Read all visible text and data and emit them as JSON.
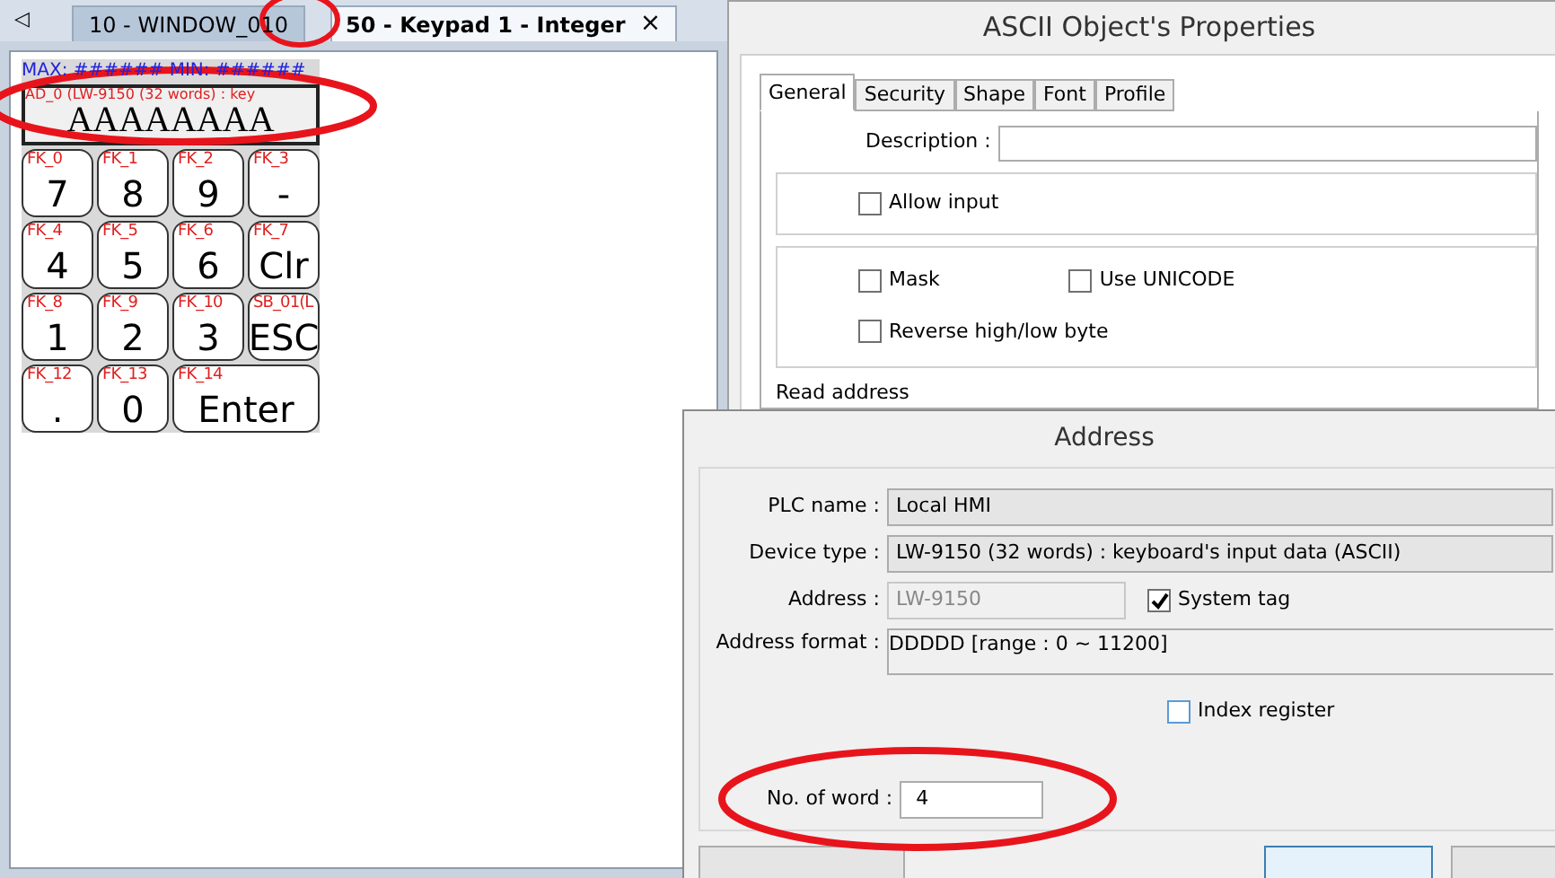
{
  "editor": {
    "scroll_arrow": "◁",
    "tabs": [
      {
        "label": "10 - WINDOW_010",
        "selected": false,
        "closable": false
      },
      {
        "label": "50 - Keypad 1 - Integer",
        "selected": true,
        "closable": true
      }
    ],
    "close_glyph": "×",
    "keypad": {
      "range_label": "MAX: ######  MIN: ######",
      "display_label": "AD_0 (LW-9150 (32 words) : key",
      "display_value": "AAAAAAAA",
      "keys": [
        {
          "tag": "FK_0",
          "label": "7",
          "wide": false
        },
        {
          "tag": "FK_1",
          "label": "8",
          "wide": false
        },
        {
          "tag": "FK_2",
          "label": "9",
          "wide": false
        },
        {
          "tag": "FK_3",
          "label": "-",
          "wide": false
        },
        {
          "tag": "FK_4",
          "label": "4",
          "wide": false
        },
        {
          "tag": "FK_5",
          "label": "5",
          "wide": false
        },
        {
          "tag": "FK_6",
          "label": "6",
          "wide": false
        },
        {
          "tag": "FK_7",
          "label": "Clr",
          "wide": false
        },
        {
          "tag": "FK_8",
          "label": "1",
          "wide": false
        },
        {
          "tag": "FK_9",
          "label": "2",
          "wide": false
        },
        {
          "tag": "FK_10",
          "label": "3",
          "wide": false
        },
        {
          "tag": "SB_01(L",
          "label": "ESC",
          "wide": false
        },
        {
          "tag": "FK_12",
          "label": ".",
          "wide": false
        },
        {
          "tag": "FK_13",
          "label": "0",
          "wide": false
        },
        {
          "tag": "FK_14",
          "label": "Enter",
          "wide": true
        }
      ]
    }
  },
  "properties_dialog": {
    "title": "ASCII Object's Properties",
    "tabs": [
      {
        "label": "General",
        "selected": true
      },
      {
        "label": "Security",
        "selected": false
      },
      {
        "label": "Shape",
        "selected": false
      },
      {
        "label": "Font",
        "selected": false
      },
      {
        "label": "Profile",
        "selected": false
      }
    ],
    "description_label": "Description :",
    "allow_input": {
      "label": "Allow input",
      "checked": false
    },
    "mask": {
      "label": "Mask",
      "checked": false
    },
    "use_unicode": {
      "label": "Use UNICODE",
      "checked": false
    },
    "reverse": {
      "label": "Reverse high/low byte",
      "checked": false
    },
    "read_address_label": "Read address"
  },
  "address_dialog": {
    "title": "Address",
    "plc_name_label": "PLC name :",
    "plc_name": "Local HMI",
    "device_type_label": "Device type :",
    "device_type": "LW-9150 (32 words) : keyboard's input data (ASCII)",
    "address_label": "Address :",
    "address": "LW-9150",
    "system_tag": {
      "label": "System tag",
      "checked": true
    },
    "address_format_label": "Address format :",
    "address_format": "DDDDD [range : 0 ~ 11200]",
    "index_register": {
      "label": "Index register",
      "checked": false
    },
    "word_count_label": "No. of word :",
    "word_count": "4"
  }
}
